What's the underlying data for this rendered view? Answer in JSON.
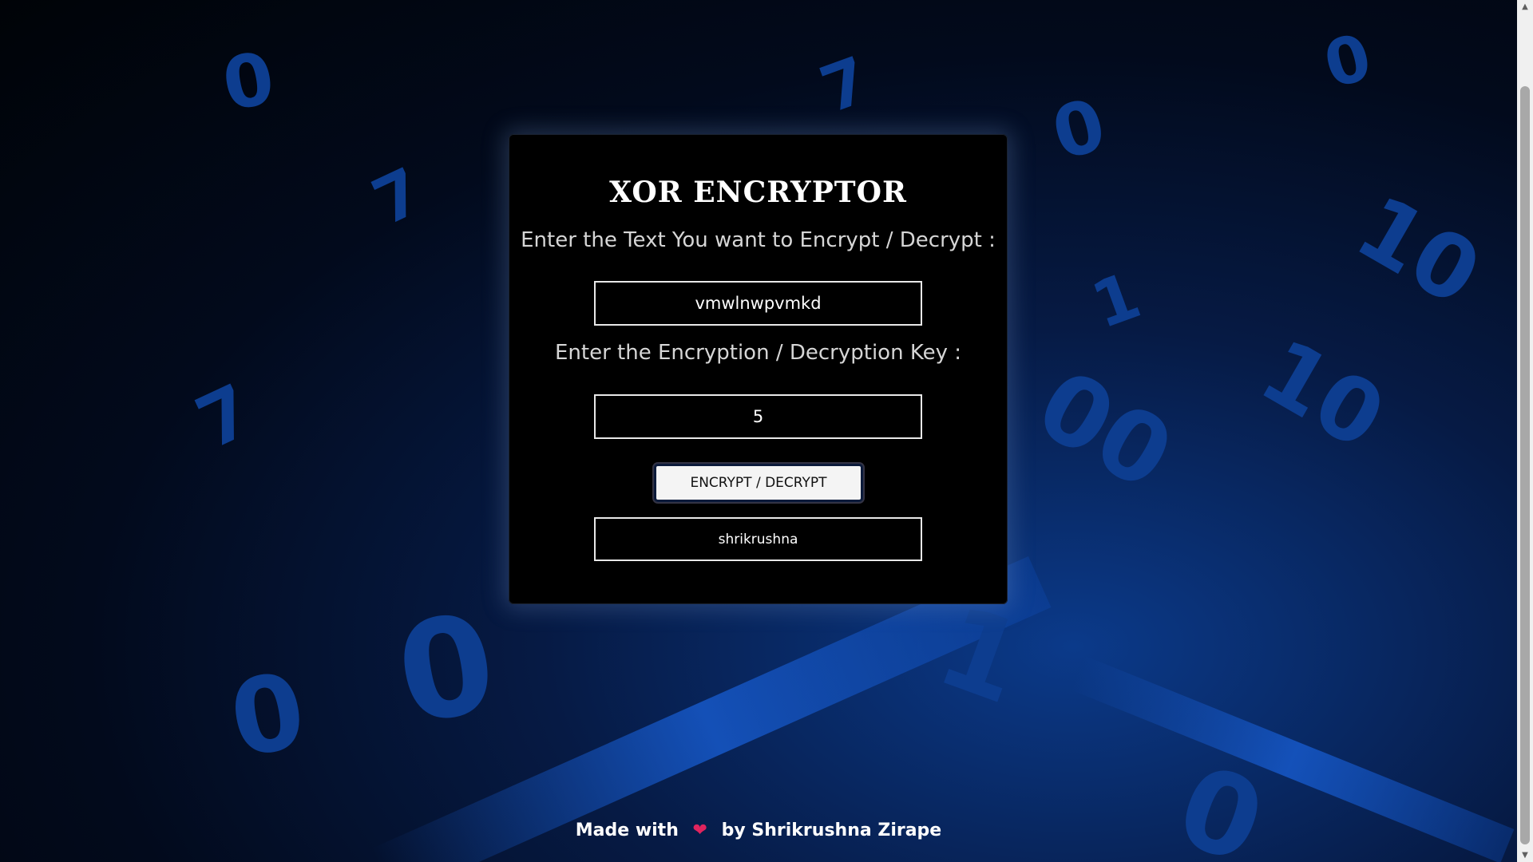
{
  "app": {
    "title": "XOR ENCRYPTOR"
  },
  "form": {
    "text_label": "Enter the Text You want to Encrypt / Decrypt :",
    "text_value": "vmwlnwpvmkd",
    "key_label": "Enter the Encryption / Decryption Key :",
    "key_value": "5",
    "button_label": "ENCRYPT / DECRYPT",
    "output_value": "shrikrushna"
  },
  "footer": {
    "prefix": "Made with",
    "heart_icon": "heart-icon",
    "suffix": "by Shrikrushna Zirape"
  },
  "colors": {
    "background_deep": "#000307",
    "background_accent": "#0b3a8a",
    "card": "#000000",
    "text": "#ffffff",
    "heart": "#e0245e"
  }
}
